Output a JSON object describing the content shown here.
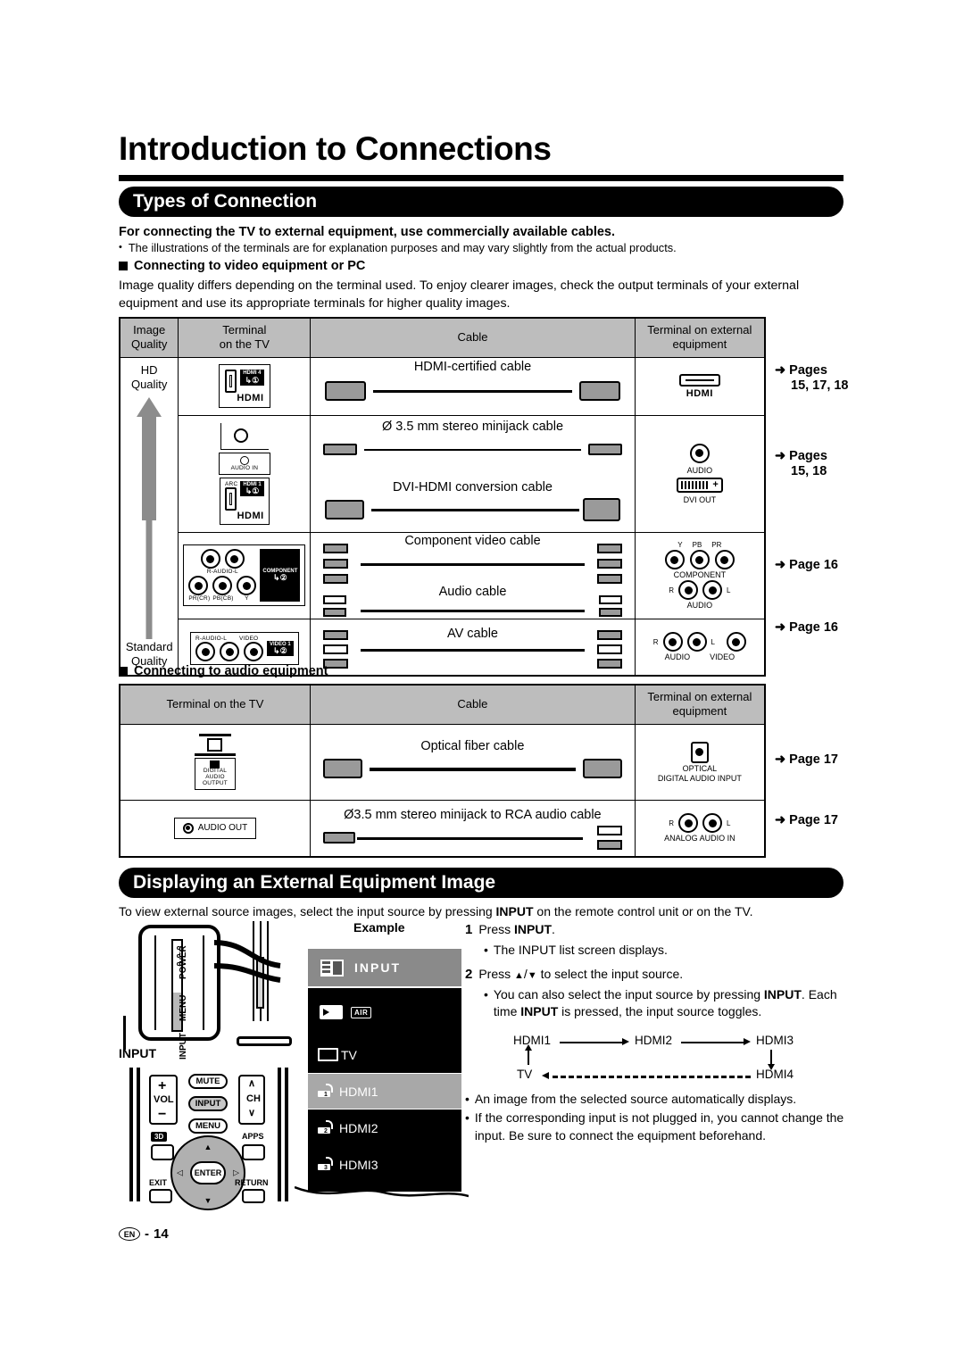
{
  "document": {
    "title": "Introduction to Connections",
    "footer_locale": "EN",
    "footer_separator": "-",
    "footer_page": "14"
  },
  "section_types_of_connection": {
    "banner": "Types of Connection",
    "lead": "For connecting the TV to external equipment, use commercially available cables.",
    "bullet_dot": "•",
    "bullet": "The illustrations of the terminals are for explanation purposes and may vary slightly from the actual products.",
    "video_subhead": "Connecting to video equipment or PC",
    "video_paragraph": "Image quality differs depending on the terminal used. To enjoy clearer images, check the output terminals of your external equipment and use its appropriate terminals for higher quality images.",
    "audio_subhead": "Connecting to audio equipment"
  },
  "video_table": {
    "headers": [
      "Image\nQuality",
      "Terminal\non the TV",
      "Cable",
      "Terminal on external\nequipment"
    ],
    "header_image_quality_l1": "Image",
    "header_image_quality_l2": "Quality",
    "header_terminal_tv_l1": "Terminal",
    "header_terminal_tv_l2": "on the TV",
    "header_cable": "Cable",
    "header_terminal_ext_l1": "Terminal on external",
    "header_terminal_ext_l2": "equipment",
    "quality_top_l1": "HD",
    "quality_top_l2": "Quality",
    "quality_bottom_l1": "Standard",
    "quality_bottom_l2": "Quality",
    "rows": [
      {
        "cable": "HDMI-certified cable",
        "tv_terminal": {
          "tag": "HDMI 4",
          "word": "HDMI"
        },
        "ext_terminal": {
          "word": "HDMI"
        },
        "pageref": {
          "arrow": "➜",
          "line1": "Pages",
          "line2": "15, 17, 18"
        }
      },
      {
        "cable_a": "Ø 3.5 mm stereo minijack cable",
        "cable_b": "DVI-HDMI conversion cable",
        "tv_terminal": {
          "audio_in": "AUDIO IN",
          "arc": "ARC",
          "tag": "HDMI 1",
          "word": "HDMI"
        },
        "ext_terminal": {
          "audio": "AUDIO",
          "dvi": "DVI OUT"
        },
        "pageref": {
          "arrow": "➜",
          "line1": "Pages",
          "line2": "15, 18"
        }
      },
      {
        "cable_a": "Component video cable",
        "cable_b": "Audio cable",
        "tv_terminal": {
          "tag": "COMPONENT",
          "audio": "R-AUDIO-L",
          "pr": "PR(CR)",
          "pb": "PB(CB)",
          "y": "Y"
        },
        "ext_terminal": {
          "y": "Y",
          "pb": "PB",
          "pr": "PR",
          "component": "COMPONENT",
          "r": "R",
          "l": "L",
          "audio": "AUDIO"
        },
        "pageref": {
          "arrow": "➜",
          "line1": "Page 16"
        }
      },
      {
        "cable": "AV cable",
        "tv_terminal": {
          "audio": "R-AUDIO-L",
          "video": "VIDEO",
          "tag": "VIDEO 1"
        },
        "ext_terminal": {
          "r": "R",
          "l": "L",
          "audio": "AUDIO",
          "video": "VIDEO"
        },
        "pageref": {
          "arrow": "➜",
          "line1": "Page 16"
        }
      }
    ]
  },
  "audio_table": {
    "header_terminal_tv": "Terminal on the TV",
    "header_cable": "Cable",
    "header_terminal_ext_l1": "Terminal on external",
    "header_terminal_ext_l2": "equipment",
    "rows": [
      {
        "cable": "Optical fiber cable",
        "tv_terminal": {
          "l1": "DIGITAL",
          "l2": "AUDIO",
          "l3": "OUTPUT"
        },
        "ext_terminal": {
          "l1": "OPTICAL",
          "l2": "DIGITAL AUDIO INPUT"
        },
        "pageref": {
          "arrow": "➜",
          "line1": "Page 17"
        }
      },
      {
        "cable": "Ø3.5 mm stereo minijack to RCA audio cable",
        "tv_terminal": {
          "label": "AUDIO OUT"
        },
        "ext_terminal": {
          "r": "R",
          "l": "L",
          "label": "ANALOG AUDIO IN"
        },
        "pageref": {
          "arrow": "➜",
          "line1": "Page 17"
        }
      }
    ]
  },
  "section_display_image": {
    "banner": "Displaying an External Equipment Image",
    "intro_a": "To view external source images, select the input source by pressing ",
    "intro_b": "INPUT",
    "intro_c": " on the remote control unit or on the TV.",
    "example_label": "Example",
    "step1": {
      "num": "1",
      "text_a": "Press ",
      "text_b": "INPUT",
      "text_c": "."
    },
    "step1_bullet": {
      "dot": "•",
      "text": "The INPUT list screen displays."
    },
    "step2": {
      "num": "2",
      "text_a": "Press ",
      "up": "▲",
      "slash": "/",
      "down": "▼",
      "text_b": " to select the input source."
    },
    "step2_bullet": {
      "dot": "•",
      "part1": "You can also select the input source by pressing ",
      "bold1": "INPUT",
      "part2": ". Each time ",
      "bold2": "INPUT",
      "part3": " is pressed, the input source toggles."
    },
    "toggle": {
      "hdmi1": "HDMI1",
      "hdmi2": "HDMI2",
      "hdmi3": "HDMI3",
      "hdmi4": "HDMI4",
      "tv": "TV"
    },
    "final_bullets": [
      {
        "dot": "•",
        "text": "An image from the selected source automatically displays."
      },
      {
        "dot": "•",
        "text": "If the corresponding input is not plugged in, you cannot change the input. Be sure to connect the equipment beforehand."
      }
    ]
  },
  "input_screen": {
    "header_title": "INPUT",
    "air_tag": "AIR",
    "items": [
      {
        "label": "TV",
        "selected": false
      },
      {
        "label": "HDMI1",
        "selected": true,
        "num": "1"
      },
      {
        "label": "HDMI2",
        "selected": false,
        "num": "2"
      },
      {
        "label": "HDMI3",
        "selected": false,
        "num": "3"
      }
    ]
  },
  "tv_illustration": {
    "power": "POWER",
    "menu": "MENU",
    "input": "INPUT",
    "callout": "INPUT"
  },
  "remote": {
    "vol": "VOL",
    "plus": "+",
    "minus": "−",
    "mute": "MUTE",
    "input": "INPUT",
    "menu": "MENU",
    "ch": "CH",
    "ch_up": "∧",
    "ch_down": "∨",
    "tag_3d": "3D",
    "apps": "APPS",
    "enter": "ENTER",
    "exit": "EXIT",
    "return": "RETURN",
    "up": "▲",
    "down": "▼",
    "left": "◁",
    "right": "▷"
  },
  "colors": {
    "banner_bg": "#000000",
    "table_header_bg": "#bdbdbd",
    "arrow_grey": "#8c8c8c",
    "screen_bg": "#000000",
    "screen_header_bg": "#8a8a8a",
    "screen_selected_bg": "#a8a8a8"
  }
}
